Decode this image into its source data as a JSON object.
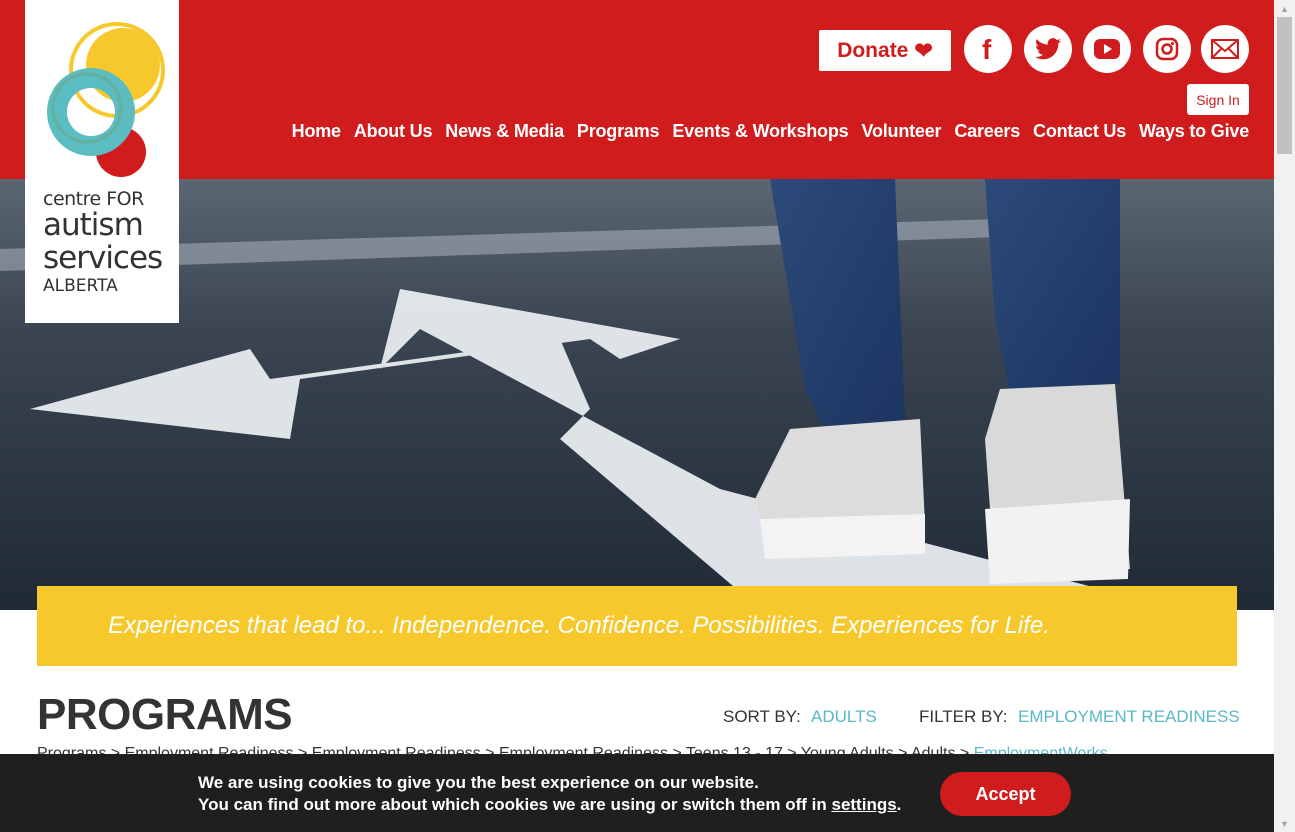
{
  "logo": {
    "line1": "centre FOR",
    "line2": "autism",
    "line3": "services",
    "line4": "ALBERTA"
  },
  "header": {
    "donate_label": "Donate",
    "social": [
      {
        "name": "facebook-icon",
        "glyph": "f"
      },
      {
        "name": "twitter-icon",
        "glyph": "bird"
      },
      {
        "name": "youtube-icon",
        "glyph": "play"
      },
      {
        "name": "instagram-icon",
        "glyph": "camera"
      },
      {
        "name": "email-icon",
        "glyph": "envelope"
      }
    ],
    "signin_label": "Sign In",
    "nav": [
      "Home",
      "About Us",
      "News & Media",
      "Programs",
      "Events & Workshops",
      "Volunteer",
      "Careers",
      "Contact Us",
      "Ways to Give"
    ]
  },
  "hero": {
    "tagline": "Experiences that lead to... Independence. Confidence. Possibilities. Experiences for Life."
  },
  "programs": {
    "title": "PROGRAMS",
    "sort_label": "SORT BY:",
    "sort_value": "ADULTS",
    "filter_label": "FILTER BY:",
    "filter_value": "EMPLOYMENT READINESS",
    "crumbs_text": "Programs > Employment Readiness > Employment Readiness > Employment Readiness > Teens 13 - 17 > Young Adults > Adults > ",
    "crumbs_link": "EmploymentWorks"
  },
  "cookie": {
    "line1": "We are using cookies to give you the best experience on our website.",
    "line2_prefix": "You can find out more about which cookies we are using or switch them off in ",
    "line2_link": "settings",
    "line2_suffix": ".",
    "accept_label": "Accept"
  },
  "colors": {
    "brand_red": "#d01c1c",
    "tagline_yellow": "#f7c82c",
    "link_teal": "#5ab8c4",
    "cookie_bg": "#1f1f1f"
  }
}
